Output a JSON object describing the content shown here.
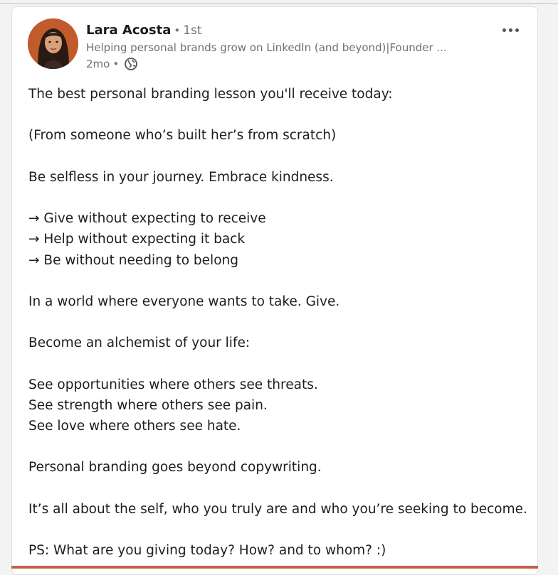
{
  "post": {
    "author": {
      "name": "Lara Acosta",
      "degree": "1st",
      "headline": "Helping personal brands grow on LinkedIn (and beyond)|Founder ...",
      "time": "2mo",
      "visibility_icon": "globe-icon"
    },
    "more_icon": "ellipsis-icon",
    "lines": [
      "The best personal branding lesson you'll receive today:",
      "",
      "(From someone who’s built her’s from scratch)",
      "",
      "Be selfless in your journey. Embrace kindness.",
      "",
      "→ Give without expecting to receive",
      "→ Help without expecting it back",
      "→ Be without needing to belong",
      "",
      "In a world where everyone wants to take. Give.",
      "",
      "Become an alchemist of your life:",
      "",
      "See opportunities where others see threats.",
      "See strength where others see pain.",
      "See love where others see hate.",
      "",
      "Personal branding goes beyond copywriting.",
      "",
      "It’s all about the self, who you truly are and who you’re seeking to become.",
      "",
      "PS: What are you giving today? How? and to whom? :)"
    ]
  },
  "colors": {
    "avatar_background": "#c25a2c",
    "name": "#1c1c1c",
    "muted": "#6f6f6f",
    "bottom_strip": "#c26148"
  }
}
